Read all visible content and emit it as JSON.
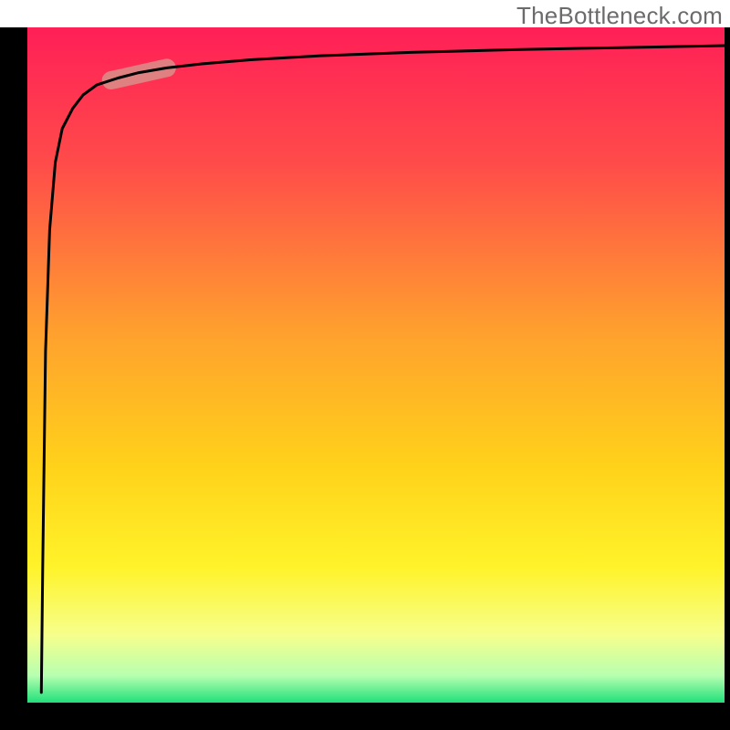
{
  "watermark": "TheBottleneck.com",
  "chart_data": {
    "type": "line",
    "title": "",
    "xlabel": "",
    "ylabel": "",
    "xlim": [
      0,
      100
    ],
    "ylim": [
      0,
      100
    ],
    "grid": false,
    "background_gradient": {
      "stops": [
        {
          "offset": 0.0,
          "color": "#ff1f57"
        },
        {
          "offset": 0.2,
          "color": "#ff4b4a"
        },
        {
          "offset": 0.45,
          "color": "#ffa02e"
        },
        {
          "offset": 0.65,
          "color": "#ffd21a"
        },
        {
          "offset": 0.8,
          "color": "#fff32a"
        },
        {
          "offset": 0.9,
          "color": "#f6ff8c"
        },
        {
          "offset": 0.96,
          "color": "#b7ffb0"
        },
        {
          "offset": 1.0,
          "color": "#21e07a"
        }
      ]
    },
    "series": [
      {
        "name": "bottleneck-curve",
        "note": "Values estimated from pixels; logarithmic-like saturation curve with vertical drop at left edge.",
        "x": [
          2.0,
          2.2,
          2.6,
          3.2,
          4.0,
          5.0,
          6.5,
          8.0,
          10,
          13,
          16,
          20,
          25,
          32,
          42,
          55,
          70,
          85,
          100
        ],
        "y": [
          1.5,
          20,
          52,
          70,
          80,
          85,
          88,
          90,
          91.5,
          92.5,
          93.3,
          94,
          94.6,
          95.2,
          95.8,
          96.3,
          96.7,
          97.0,
          97.3
        ],
        "color": "#000000",
        "stroke_width": 3
      }
    ],
    "highlight": {
      "name": "highlight-segment",
      "note": "Pink/desaturated pill highlighting portion of curve",
      "x_range": [
        12,
        20
      ],
      "y_range": [
        92,
        94
      ],
      "color": "#d98e89",
      "opacity": 0.85
    },
    "frame": {
      "color": "#000000",
      "left_width": 30,
      "bottom_height": 30,
      "right_width": 6,
      "top_height": 0
    }
  }
}
